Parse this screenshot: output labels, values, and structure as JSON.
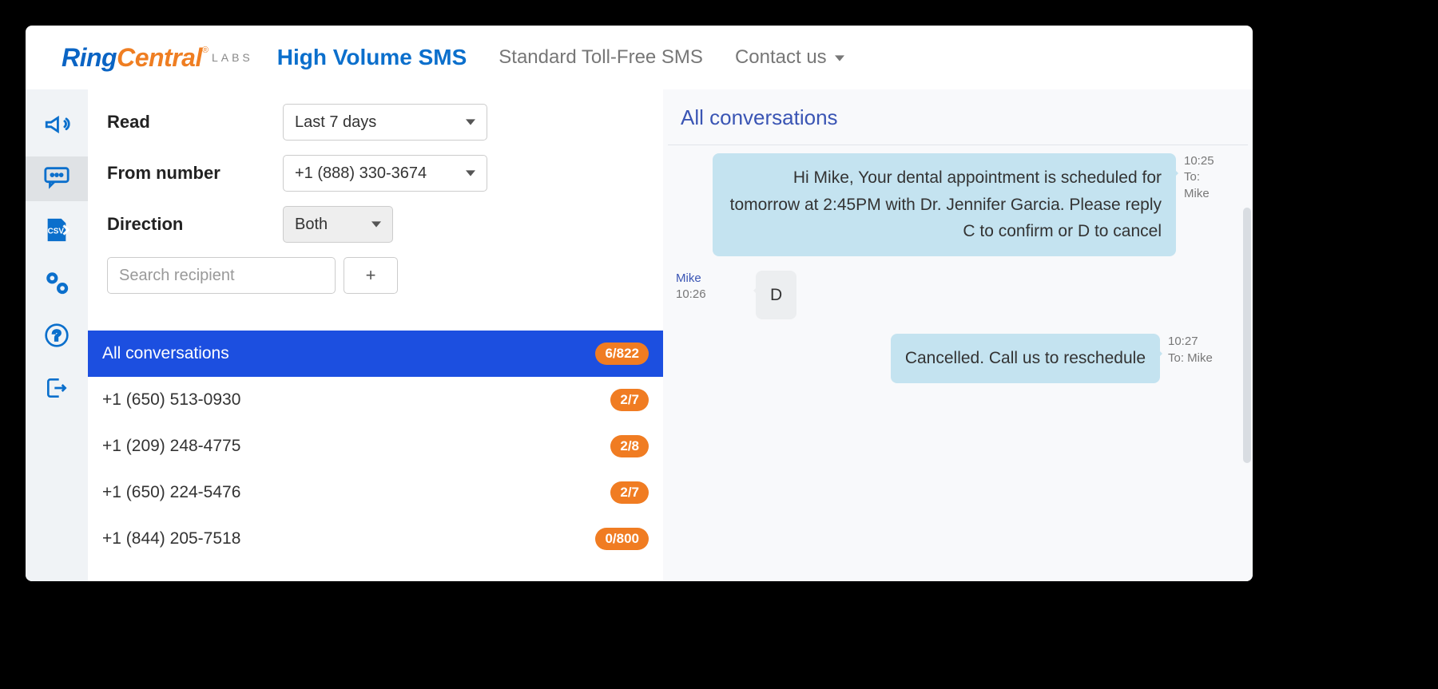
{
  "logo": {
    "part1": "Ring",
    "part2": "Central",
    "reg": "®",
    "labs": "LABS"
  },
  "nav": {
    "primary": "High Volume SMS",
    "items": [
      "Standard Toll-Free SMS",
      "Contact us"
    ]
  },
  "sidebar_icons": [
    "megaphone",
    "chat",
    "csv-export",
    "settings-gears",
    "help",
    "logout"
  ],
  "filters": {
    "read_label": "Read",
    "read_value": "Last 7 days",
    "from_label": "From number",
    "from_value": "+1 (888) 330-3674",
    "direction_label": "Direction",
    "direction_value": "Both",
    "search_placeholder": "Search recipient",
    "plus_label": "+"
  },
  "conversations": {
    "header_label": "All conversations",
    "header_badge": "6/822",
    "items": [
      {
        "label": "+1 (650) 513-0930",
        "badge": "2/7"
      },
      {
        "label": "+1 (209) 248-4775",
        "badge": "2/8"
      },
      {
        "label": "+1 (650) 224-5476",
        "badge": "2/7"
      },
      {
        "label": "+1 (844) 205-7518",
        "badge": "0/800"
      }
    ]
  },
  "chat": {
    "title": "All conversations",
    "messages": [
      {
        "dir": "out",
        "text": "Hi Mike, Your dental appointment is scheduled for tomorrow at 2:45PM with Dr. Jennifer Garcia. Please reply C to confirm or D to cancel",
        "meta_line1": "10:25",
        "meta_line2": "To:",
        "meta_line3": "Mike"
      },
      {
        "dir": "in",
        "text": "D",
        "meta_line1": "Mike",
        "meta_line2": "10:26",
        "meta_line3": ""
      },
      {
        "dir": "out",
        "text": "Cancelled. Call us to reschedule",
        "meta_line1": "10:27",
        "meta_line2": "To: Mike",
        "meta_line3": ""
      }
    ]
  },
  "colors": {
    "accent_blue": "#1c4fe0",
    "brand_blue": "#0b6fcc",
    "brand_orange": "#f07c22",
    "bubble_out": "#c4e3f0",
    "bubble_in": "#eceef0"
  }
}
